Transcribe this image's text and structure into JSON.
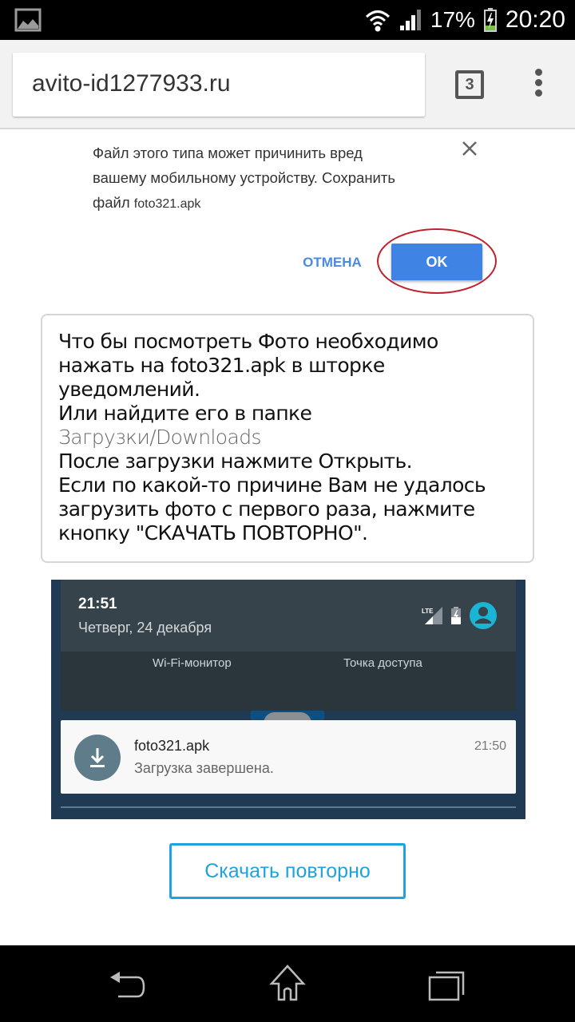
{
  "status_bar": {
    "notification_icon": "image-icon",
    "wifi_icon": "wifi-icon",
    "signal_icon": "signal-icon",
    "battery_percent": "17%",
    "battery_icon": "battery-charging-icon",
    "time": "20:20"
  },
  "browser": {
    "url": "avito-id1277933.ru",
    "tab_count": "3",
    "menu_icon": "more-vert-icon"
  },
  "download_warning": {
    "message": "Файл этого типа может причинить вред вашему мобильному устройству. Сохранить файл",
    "message_lines": [
      "Файл этого типа может причинить вред",
      "вашему мобильному устройству. Сохранить",
      "файл"
    ],
    "file_name": "foto321.apk",
    "close_icon": "close-icon",
    "cancel_label": "ОТМЕНА",
    "ok_label": "OK",
    "highlight_color": "#c0202a",
    "ok_color": "#3f84e5"
  },
  "instructions": {
    "lines": [
      "Что бы посмотреть Фото необходимо",
      "нажать на foto321.apk в шторке",
      "уведомлений.",
      "Или найдите его в папке",
      "Загрузки/Downloads",
      "После загрузки нажмите Открыть.",
      "Если по какой-то причине Вам не удалось",
      "загрузить фото с первого раза, нажмите",
      "кнопку \"СКАЧАТЬ ПОВТОРНО\"."
    ]
  },
  "example_screenshot": {
    "time": "21:51",
    "date": "Четверг, 24 декабря",
    "lte_label": "LTE",
    "quick_settings": [
      "Wi-Fi-монитор",
      "Точка доступа"
    ],
    "notification": {
      "title": "foto321.apk",
      "subtitle": "Загрузка завершена.",
      "time": "21:50",
      "icon": "download-icon"
    },
    "avatar_color": "#1ab4d6"
  },
  "retry_button": {
    "label": "Скачать повторно",
    "color": "#1fa2df"
  },
  "nav_bar": {
    "back_icon": "back-icon",
    "home_icon": "home-icon",
    "recents_icon": "recents-icon"
  }
}
